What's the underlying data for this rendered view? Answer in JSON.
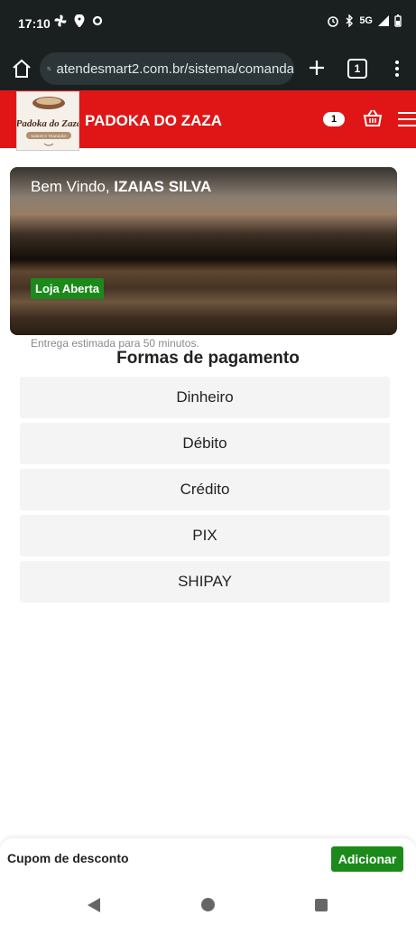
{
  "status_bar": {
    "time": "17:10",
    "network": "5G"
  },
  "browser": {
    "url": "atendesmart2.com.br/sistema/comanda",
    "tab_count": "1"
  },
  "store": {
    "name": "PADOKA DO ZAZA",
    "logo_text": "Padoka do Zaza",
    "logo_tagline": "SABOR E TRADIÇÃO",
    "cart_count": "1",
    "brand_color": "#e01616"
  },
  "banner": {
    "welcome_prefix": "Bem Vindo, ",
    "user_name": "IZAIAS SILVA",
    "store_status": "Loja Aberta"
  },
  "delivery_note": "Entrega estimada para 50 minutos.",
  "payment": {
    "title": "Formas de pagamento",
    "options": [
      "Dinheiro",
      "Débito",
      "Crédito",
      "PIX",
      "SHIPAY"
    ]
  },
  "coupon": {
    "label": "Cupom de desconto",
    "button_label": "Adicionar",
    "button_color": "#1b8a1b"
  }
}
